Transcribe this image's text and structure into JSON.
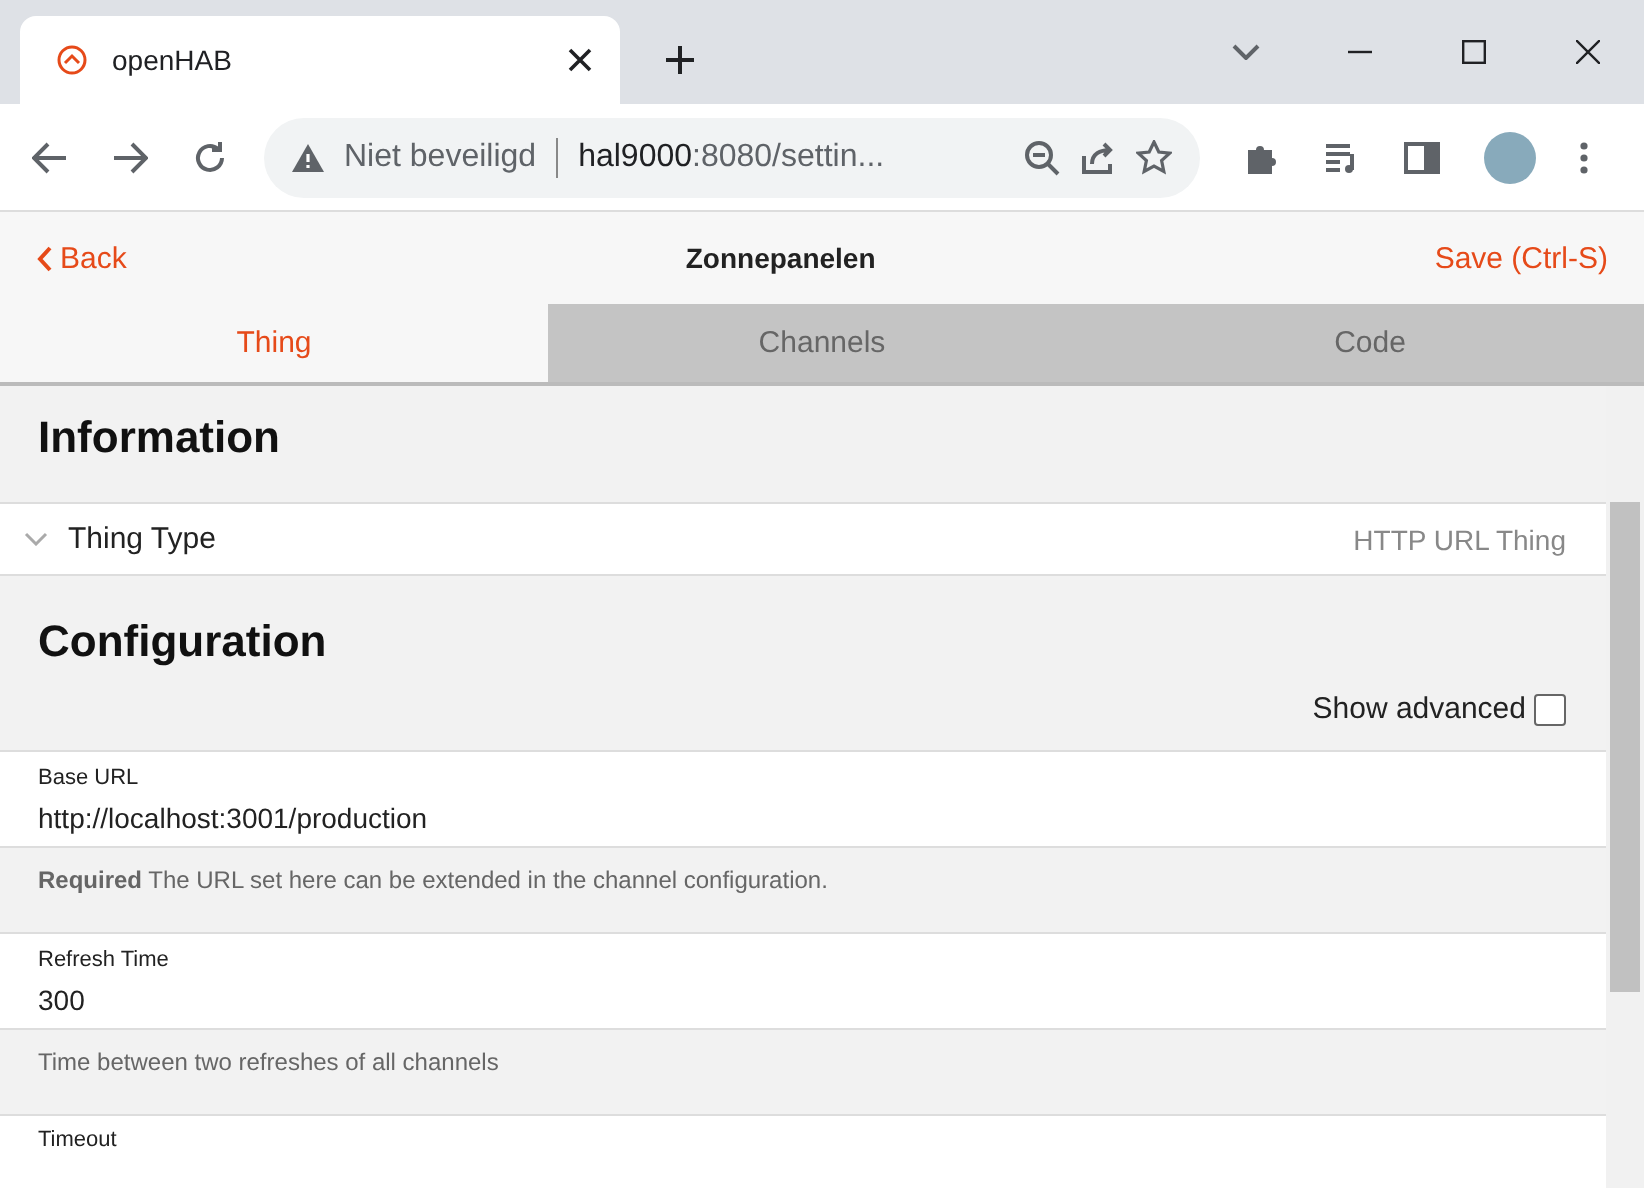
{
  "browser": {
    "tab_title": "openHAB",
    "address_warning": "Niet beveiligd",
    "address_host": "hal9000",
    "address_rest": ":8080/settin..."
  },
  "header": {
    "back": "Back",
    "title": "Zonnepanelen",
    "save": "Save (Ctrl-S)"
  },
  "tabs": [
    {
      "label": "Thing",
      "selected": true
    },
    {
      "label": "Channels",
      "selected": false
    },
    {
      "label": "Code",
      "selected": false
    }
  ],
  "information": {
    "heading": "Information",
    "items": [
      {
        "label": "Thing Type",
        "value": "HTTP URL Thing",
        "expanded": false
      }
    ]
  },
  "configuration": {
    "heading": "Configuration",
    "show_advanced": {
      "label": "Show advanced",
      "checked": false
    },
    "parameters": [
      {
        "label": "Base URL",
        "value": "http://localhost:3001/production",
        "description": "**Required** The URL set here can be extended in the channel configuration."
      },
      {
        "label": "Refresh Time",
        "value": "300",
        "description": "Time between two refreshes of all channels"
      },
      {
        "label": "Timeout"
      }
    ]
  }
}
